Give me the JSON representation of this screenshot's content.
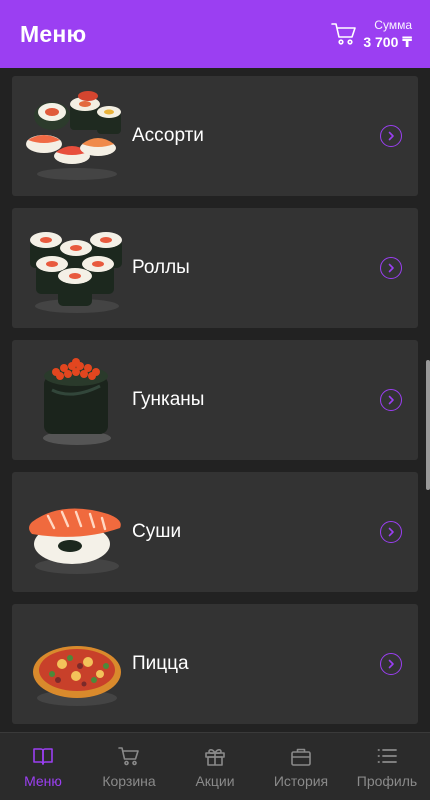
{
  "header": {
    "title": "Меню",
    "sum_label": "Сумма",
    "sum_value": "3 700 ₸"
  },
  "categories": [
    {
      "label": "Ассорти",
      "icon": "sushi-assorted-icon"
    },
    {
      "label": "Роллы",
      "icon": "rolls-icon"
    },
    {
      "label": "Гунканы",
      "icon": "gunkan-icon"
    },
    {
      "label": "Суши",
      "icon": "nigiri-icon"
    },
    {
      "label": "Пицца",
      "icon": "pizza-icon"
    }
  ],
  "bottom_nav": [
    {
      "label": "Меню",
      "icon": "book-icon",
      "active": true
    },
    {
      "label": "Корзина",
      "icon": "cart-icon",
      "active": false
    },
    {
      "label": "Акции",
      "icon": "gift-icon",
      "active": false
    },
    {
      "label": "История",
      "icon": "briefcase-icon",
      "active": false
    },
    {
      "label": "Профиль",
      "icon": "list-icon",
      "active": false
    }
  ],
  "colors": {
    "accent": "#9b3ff2",
    "card": "#333333",
    "background": "#222222",
    "nav_inactive": "#8a8a8a"
  }
}
